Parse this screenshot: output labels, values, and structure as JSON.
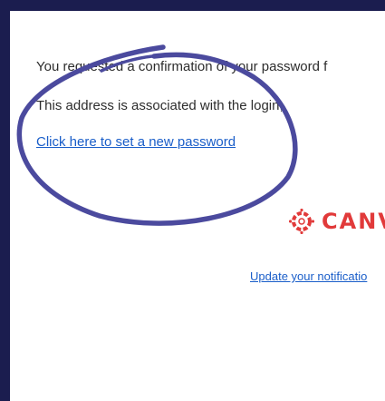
{
  "email": {
    "intro": "You requested a confirmation of your password f",
    "association": "This address is associated with the login,",
    "reset_link": "Click here to set a new password",
    "logo_text": "CANV",
    "logo_icon": "canvas-logo-icon",
    "notification_link": "Update your notificatio"
  },
  "colors": {
    "background": "#1b1d4f",
    "link": "#1a5ec9",
    "brand": "#e13a3a",
    "annotation": "#4b4a9e"
  }
}
